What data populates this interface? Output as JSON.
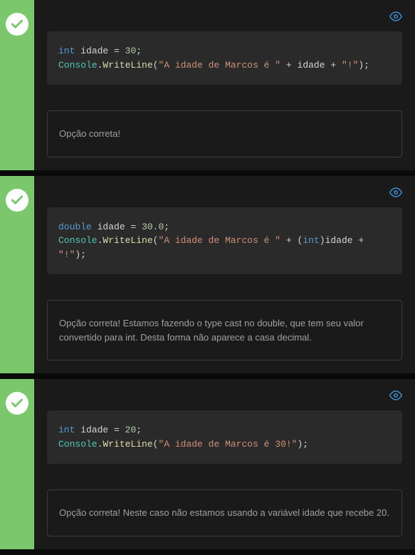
{
  "options": [
    {
      "code_html": "<span class='kw'>int</span> <span class='var'>idade</span> <span class='op'>=</span> <span class='num'>30</span><span class='punct'>;</span>\n<span class='cls'>Console</span><span class='punct'>.</span><span class='method'>WriteLine</span><span class='paren'>(</span><span class='str'>\"A idade de Marcos é \"</span> <span class='op'>+</span> <span class='var'>idade</span> <span class='op'>+</span> <span class='str'>\"!\"</span><span class='paren'>)</span><span class='punct'>;</span>",
      "feedback": "Opção correta!"
    },
    {
      "code_html": "<span class='kw'>double</span> <span class='var'>idade</span> <span class='op'>=</span> <span class='num'>30.0</span><span class='punct'>;</span>\n<span class='cls'>Console</span><span class='punct'>.</span><span class='method'>WriteLine</span><span class='paren'>(</span><span class='str'>\"A idade de Marcos é \"</span> <span class='op'>+</span> <span class='paren'>(</span><span class='cast'>int</span><span class='paren'>)</span><span class='var'>idade</span> <span class='op'>+</span> <span class='str'>\"!\"</span><span class='paren'>)</span><span class='punct'>;</span>",
      "feedback": "Opção correta! Estamos fazendo o type cast no double, que tem seu valor convertido para int. Desta forma não aparece a casa decimal."
    },
    {
      "code_html": "<span class='kw'>int</span> <span class='var'>idade</span> <span class='op'>=</span> <span class='num'>20</span><span class='punct'>;</span>\n<span class='cls'>Console</span><span class='punct'>.</span><span class='method'>WriteLine</span><span class='paren'>(</span><span class='str'>\"A idade de Marcos é 30!\"</span><span class='paren'>)</span><span class='punct'>;</span>",
      "feedback": "Opção correta! Neste caso não estamos usando a variável idade que recebe 20."
    }
  ]
}
